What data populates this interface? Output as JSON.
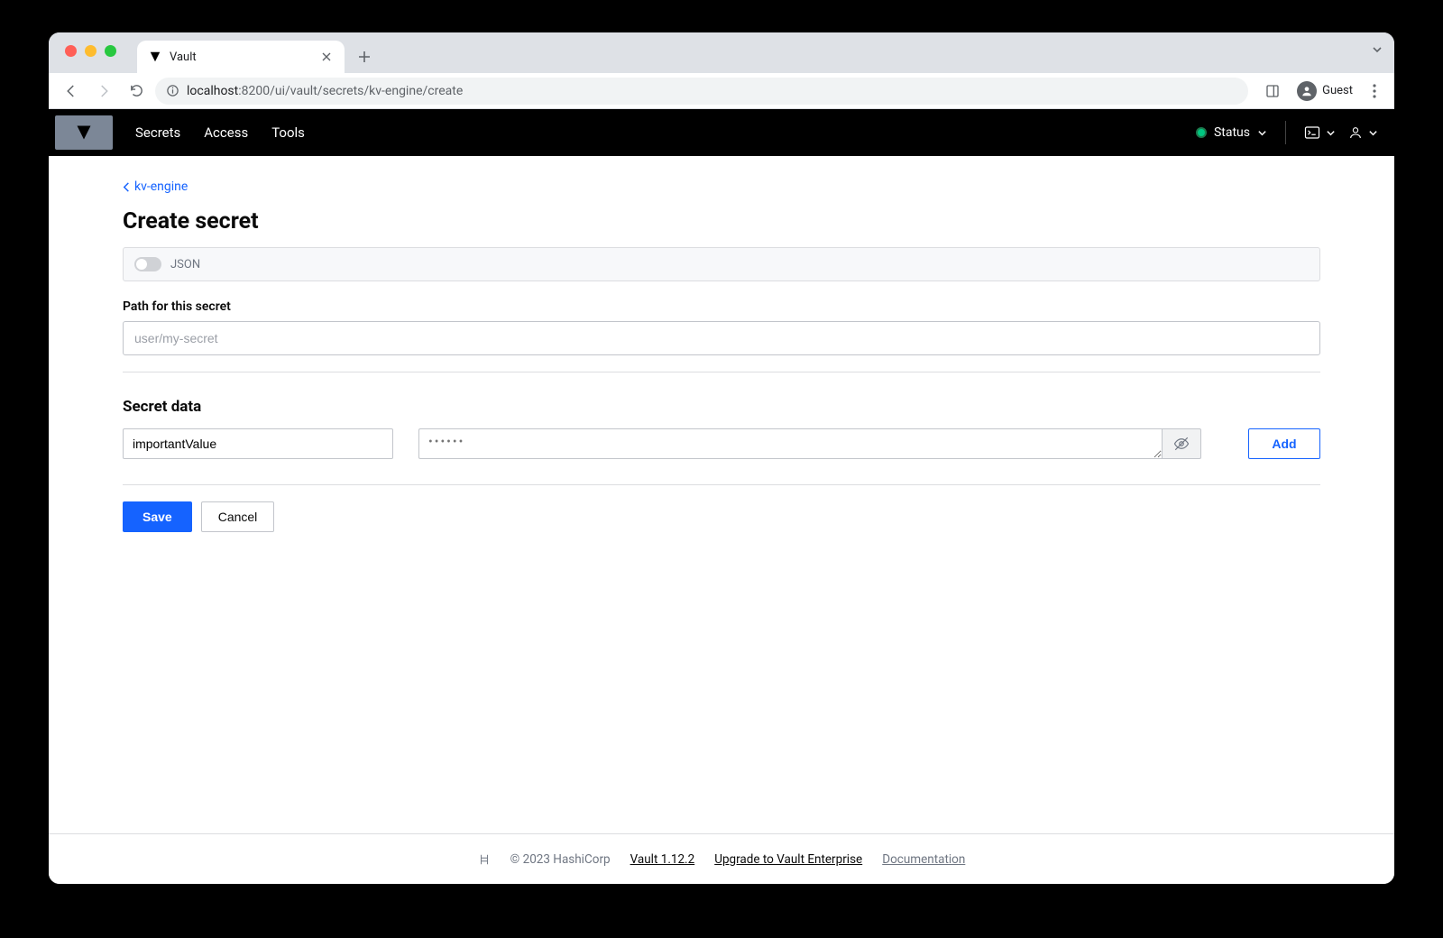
{
  "browser": {
    "tab_title": "Vault",
    "url_host": "localhost",
    "url_port": ":8200",
    "url_path": "/ui/vault/secrets/kv-engine/create",
    "guest_label": "Guest"
  },
  "nav": {
    "links": [
      "Secrets",
      "Access",
      "Tools"
    ],
    "status_label": "Status"
  },
  "page": {
    "breadcrumb": "kv-engine",
    "title": "Create secret",
    "json_toggle_label": "JSON",
    "path_label": "Path for this secret",
    "path_placeholder": "user/my-secret",
    "path_value": "",
    "secret_data_heading": "Secret data",
    "kv_key_value": "importantValue",
    "kv_val_masked": "••••••",
    "add_label": "Add",
    "save_label": "Save",
    "cancel_label": "Cancel"
  },
  "footer": {
    "copyright": "© 2023 HashiCorp",
    "version": "Vault 1.12.2",
    "upgrade": "Upgrade to Vault Enterprise",
    "docs": "Documentation"
  }
}
